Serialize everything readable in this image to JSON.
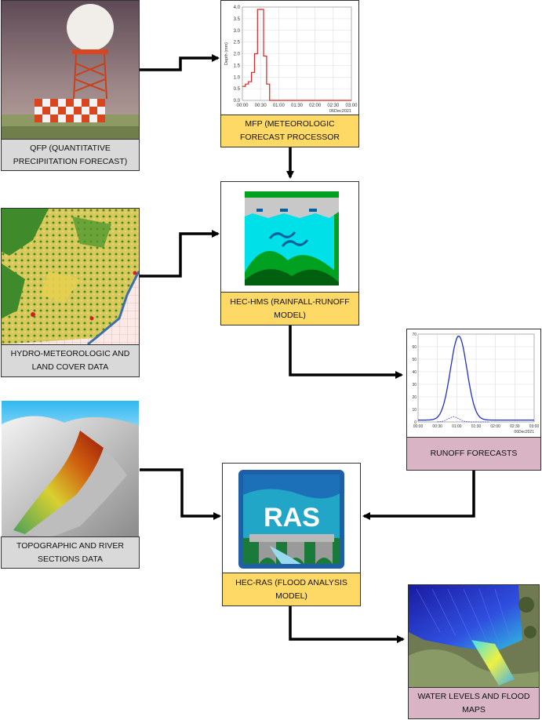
{
  "nodes": {
    "qfp": {
      "label": "QFP (QUANTITATIVE PRECIPIITATION FORECAST)"
    },
    "mfp": {
      "label": "MFP (METEOROLOGIC FORECAST PROCESSOR"
    },
    "hydro": {
      "label": "HYDRO-METEOROLOGIC AND LAND COVER DATA"
    },
    "hms": {
      "label": "HEC-HMS (RAINFALL-RUNOFF MODEL)"
    },
    "runoff": {
      "label": "RUNOFF FORECASTS"
    },
    "topo": {
      "label": "TOPOGRAPHIC AND RIVER SECTIONS DATA"
    },
    "ras": {
      "label": "HEC-RAS (FLOOD ANALYSIS MODEL)",
      "logo_text": "RAS"
    },
    "flood": {
      "label": "WATER LEVELS AND FLOOD MAPS"
    }
  },
  "mfp_chart": {
    "type": "line",
    "ylabel": "Depth (mm)",
    "y_ticks": [
      "0.0",
      "0.5",
      "1.0",
      "1.5",
      "2.0",
      "2.5",
      "3.0",
      "3.5",
      "4.0"
    ],
    "x_ticks": [
      "00:00",
      "00:30",
      "01:00",
      "01:30",
      "02:00",
      "02:30",
      "03:00"
    ],
    "date_label": "06Dec2021",
    "ylim": [
      0,
      4
    ],
    "x": [
      0,
      5,
      10,
      15,
      20,
      25,
      30,
      35,
      40,
      45,
      50,
      55,
      60,
      180
    ],
    "y": [
      0.6,
      0.7,
      0.8,
      1.2,
      2.0,
      3.9,
      3.9,
      1.9,
      0.7,
      0.0,
      0.0,
      0.0,
      0.0,
      0.0
    ],
    "color": "#e02020"
  },
  "runoff_chart": {
    "type": "line",
    "y_ticks": [
      "0",
      "10",
      "20",
      "30",
      "40",
      "50",
      "60",
      "70"
    ],
    "x_ticks": [
      "00:00",
      "00:30",
      "01:00",
      "01:30",
      "02:00",
      "02:30",
      "03:00"
    ],
    "date_label": "06Dec2021",
    "ylim": [
      0,
      70
    ],
    "color": "#1f2fcf"
  },
  "colors": {
    "gray_label": "#d9d9d9",
    "yellow_label": "#ffd966",
    "pink_label": "#d8b4c4",
    "arrow": "#000000"
  }
}
